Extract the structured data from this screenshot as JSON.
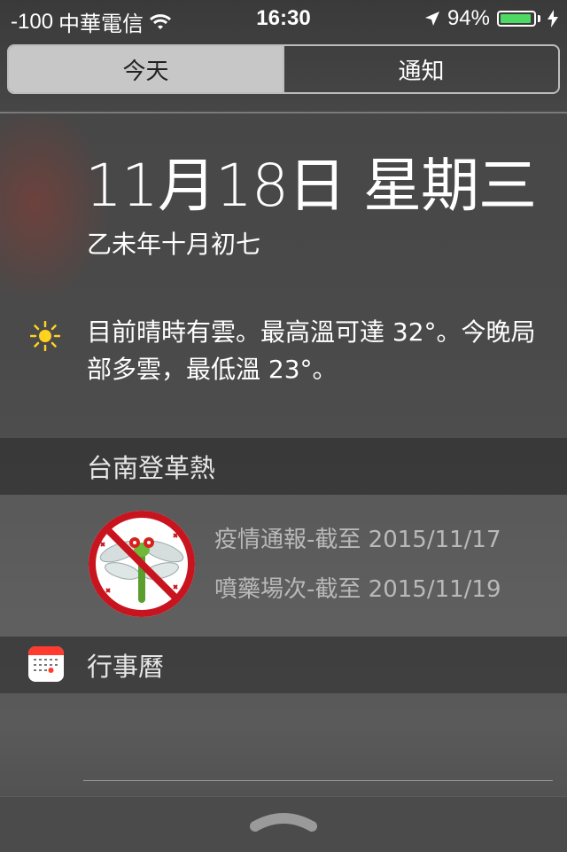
{
  "status_bar": {
    "signal": "-100",
    "carrier": "中華電信",
    "time": "16:30",
    "battery_percent": "94%",
    "battery_level": 0.94,
    "icons": [
      "wifi-icon",
      "location-arrow-icon",
      "battery-icon",
      "charging-bolt-icon"
    ],
    "battery_color": "#4cd964"
  },
  "tabs": [
    {
      "label": "今天",
      "active": true
    },
    {
      "label": "通知",
      "active": false
    }
  ],
  "today": {
    "date": "11月18日 星期三",
    "lunar_date": "乙未年十月初七",
    "weather_icon": "sun-icon",
    "weather_summary": "目前晴時有雲。最高溫可達 32°。今晚局部多雲，最低溫 23°。"
  },
  "widgets": {
    "dengue": {
      "title": "台南登革熱",
      "logo": "no-mosquito-logo",
      "lines": [
        "疫情通報-截至 2015/11/17",
        "噴藥場次-截至 2015/11/19"
      ]
    },
    "calendar": {
      "title": "行事曆",
      "icon": "calendar-icon"
    }
  },
  "bottom": {
    "handle_icon": "pull-up-grabber-icon"
  }
}
